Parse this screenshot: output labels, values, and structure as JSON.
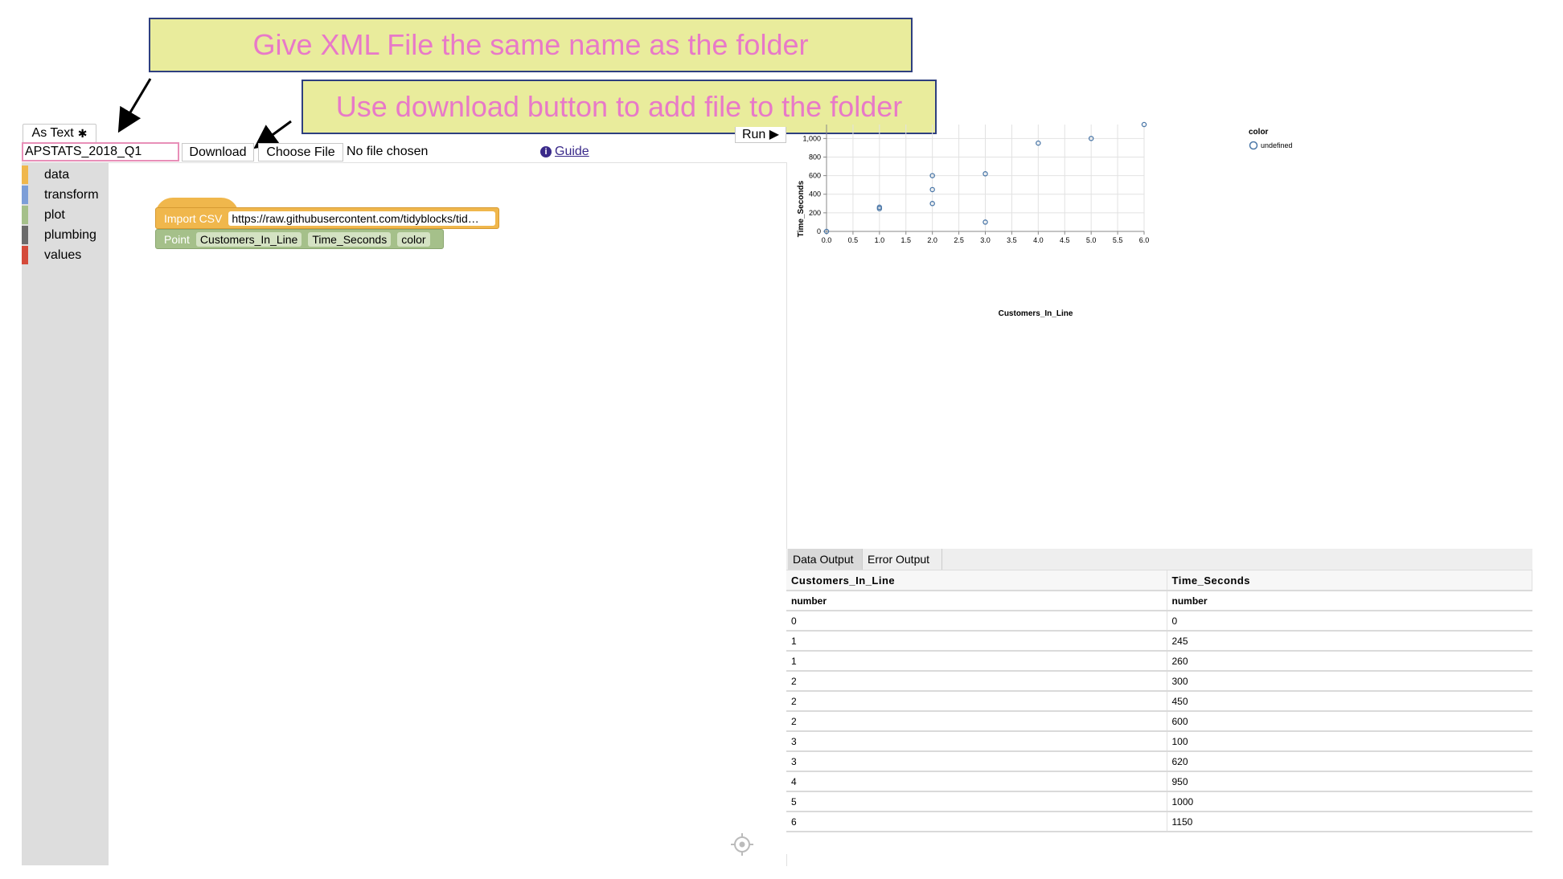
{
  "callouts": {
    "top": "Give XML File the same name as the folder",
    "bottom": "Use download button to add file to the folder"
  },
  "toolbar": {
    "as_text_label": "As Text",
    "filename_value": "APSTATS_2018_Q1",
    "download_label": "Download",
    "choose_file_label": "Choose File",
    "no_file_text": "No file chosen",
    "guide_label": "Guide",
    "run_label": "Run ▶"
  },
  "toolbox": {
    "categories": [
      {
        "label": "data",
        "color": "#f0b74c"
      },
      {
        "label": "transform",
        "color": "#7c9ed8"
      },
      {
        "label": "plot",
        "color": "#a5c08a"
      },
      {
        "label": "plumbing",
        "color": "#6b6b6b"
      },
      {
        "label": "values",
        "color": "#d44a3a"
      }
    ]
  },
  "blocks": {
    "import_csv": {
      "keyword": "Import CSV",
      "url": "https://raw.githubusercontent.com/tidyblocks/tid…"
    },
    "point": {
      "keyword": "Point",
      "x_field": "Customers_In_Line",
      "y_field": "Time_Seconds",
      "color_field": "color"
    }
  },
  "output": {
    "tabs": [
      "Data Output",
      "Error Output"
    ],
    "columns": [
      "Customers_In_Line",
      "Time_Seconds"
    ],
    "types": [
      "number",
      "number"
    ],
    "rows": [
      [
        "0",
        "0"
      ],
      [
        "1",
        "245"
      ],
      [
        "1",
        "260"
      ],
      [
        "2",
        "300"
      ],
      [
        "2",
        "450"
      ],
      [
        "2",
        "600"
      ],
      [
        "3",
        "100"
      ],
      [
        "3",
        "620"
      ],
      [
        "4",
        "950"
      ],
      [
        "5",
        "1000"
      ],
      [
        "6",
        "1150"
      ]
    ]
  },
  "chart_data": {
    "type": "scatter",
    "xlabel": "Customers_In_Line",
    "ylabel": "Time_Seconds",
    "xlim": [
      0,
      6
    ],
    "ylim": [
      0,
      1150
    ],
    "x_ticks": [
      "0.0",
      "0.5",
      "1.0",
      "1.5",
      "2.0",
      "2.5",
      "3.0",
      "3.5",
      "4.0",
      "4.5",
      "5.0",
      "5.5",
      "6.0"
    ],
    "y_ticks": [
      "0",
      "200",
      "400",
      "600",
      "800",
      "1,000"
    ],
    "legend": {
      "title": "color",
      "entries": [
        "undefined"
      ],
      "placement": "top-right"
    },
    "grid": true,
    "point_color": "#4c78a8",
    "series": [
      {
        "x": [
          0,
          1,
          1,
          2,
          2,
          2,
          3,
          3,
          4,
          5,
          6
        ],
        "y": [
          0,
          245,
          260,
          300,
          450,
          600,
          100,
          620,
          950,
          1000,
          1150
        ]
      }
    ]
  }
}
